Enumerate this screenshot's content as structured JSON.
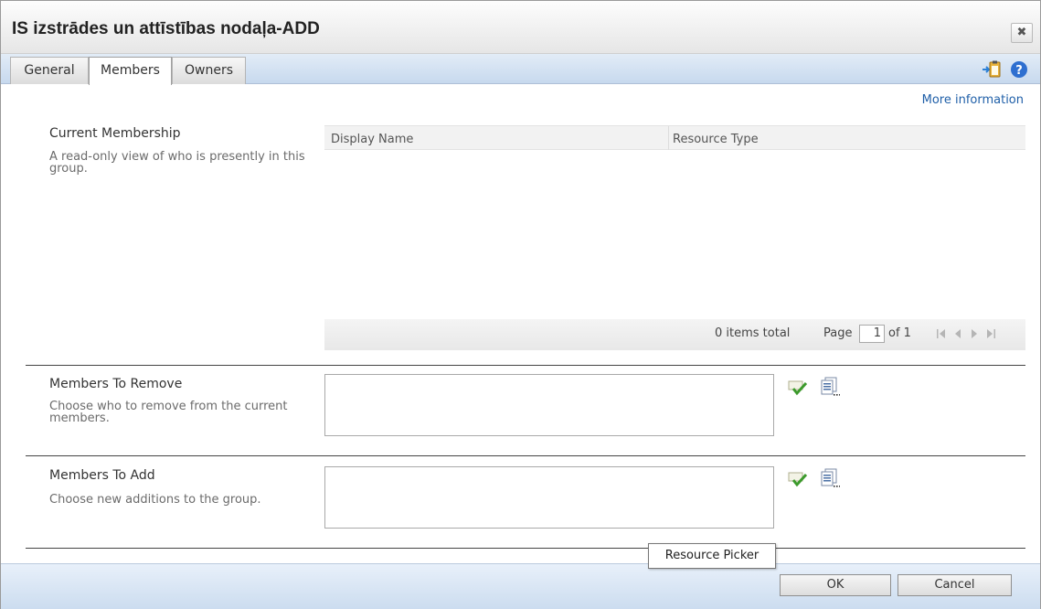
{
  "window": {
    "title": "IS izstrādes un attīstības nodaļa-ADD",
    "close_glyph": "✖"
  },
  "tabs": [
    {
      "label": "General",
      "active": false
    },
    {
      "label": "Members",
      "active": true
    },
    {
      "label": "Owners",
      "active": false
    }
  ],
  "toolbar": {
    "icons": [
      "paste-icon",
      "help-icon"
    ]
  },
  "more_info_link": "More information",
  "current_membership": {
    "title": "Current Membership",
    "description": "A read-only view of who is presently in this group.",
    "columns": [
      "Display Name",
      "Resource Type"
    ],
    "rows": [],
    "items_total": "0 items total",
    "page_label": "Page",
    "page_value": "1",
    "page_of": "of 1"
  },
  "members_to_remove": {
    "title": "Members To Remove",
    "description": "Choose who to remove from the current members.",
    "value": ""
  },
  "members_to_add": {
    "title": "Members To Add",
    "description": "Choose new additions to the group.",
    "value": ""
  },
  "tooltip": "Resource Picker",
  "buttons": {
    "ok": "OK",
    "cancel": "Cancel"
  },
  "colors": {
    "accent_blue": "#1f5fa8",
    "bar_blue": "#cbdcef",
    "check_green": "#3c9a2c"
  }
}
